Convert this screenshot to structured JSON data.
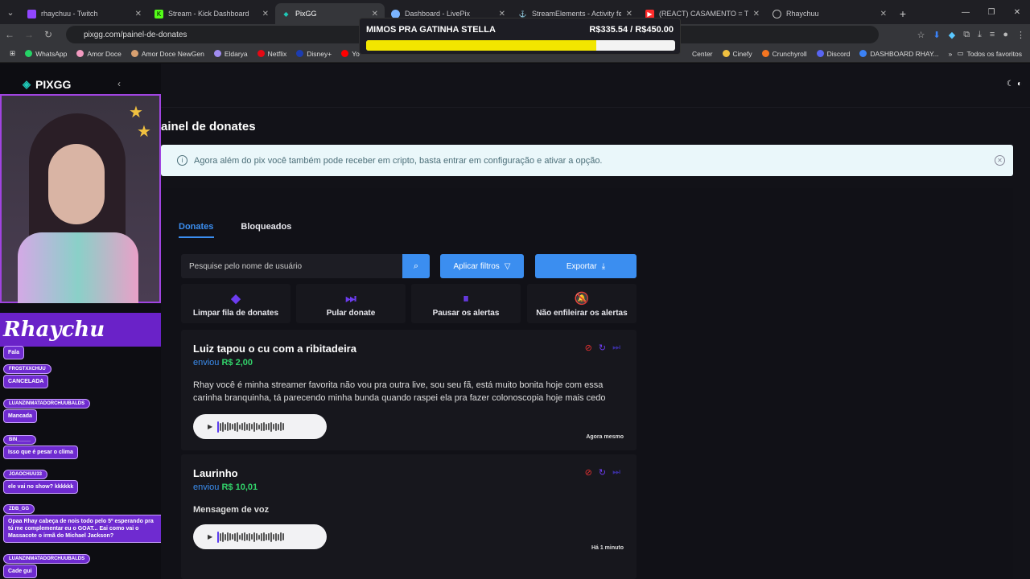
{
  "browser": {
    "tabs": [
      {
        "title": "rhaychuu - Twitch",
        "color": "#9146ff",
        "active": false
      },
      {
        "title": "Stream - Kick Dashboard",
        "color": "#53fc18",
        "active": false
      },
      {
        "title": "PixGG",
        "color": "#1fc7b6",
        "active": true
      },
      {
        "title": "Dashboard - LivePix",
        "color": "#7ab4ff",
        "active": false
      },
      {
        "title": "StreamElements - Activity feed",
        "color": "#ffffff",
        "active": false
      },
      {
        "title": "(REACT) CASAMENTO = TESTO",
        "color": "#ff2b2b",
        "active": false
      },
      {
        "title": "Rhaychuu",
        "color": "#bbbbbb",
        "active": false
      }
    ],
    "url": "pixgg.com/painel-de-donates",
    "bookmarks": [
      {
        "label": "WhatsApp",
        "color": "#25d366"
      },
      {
        "label": "Amor Doce",
        "color": "#f29ac0"
      },
      {
        "label": "Amor Doce NewGen",
        "color": "#d8a070"
      },
      {
        "label": "Eldarya",
        "color": "#a08cf0"
      },
      {
        "label": "Netflix",
        "color": "#e50914"
      },
      {
        "label": "Disney+",
        "color": "#1c3cb0"
      },
      {
        "label": "Yo",
        "color": "#ff0000"
      }
    ],
    "bookmarks_right": [
      {
        "label": "Center",
        "color": "#999999"
      },
      {
        "label": "Cinefy",
        "color": "#f0c040"
      },
      {
        "label": "Crunchyroll",
        "color": "#f47521"
      },
      {
        "label": "Discord",
        "color": "#5865f2"
      },
      {
        "label": "DASHBOARD RHAY...",
        "color": "#3b82f6"
      }
    ],
    "all_bookmarks": "Todos os favoritos"
  },
  "goal": {
    "title": "MIMOS PRA GATINHA STELLA",
    "value_text": "R$335.54 / R$450.00",
    "progress": 0.7456
  },
  "sidebar": {
    "logo_text": "PIXGG",
    "brand_text": "Rhaychu",
    "chat": [
      {
        "user": "",
        "msg": "Fala"
      },
      {
        "user": "FROSTXXCHUU",
        "msg": "CANCELADA"
      },
      {
        "user": "LUANZINMATADORCHUUBALDS",
        "msg": "Mancada"
      },
      {
        "user": "BIN_____",
        "msg": "Isso que é pesar o clima"
      },
      {
        "user": "JOAOCHUU33",
        "msg": "ele vai no show? kkkkkk"
      },
      {
        "user": "ZDB_GG",
        "msg": "Opaa Rhay cabeça de nois todo pelo 5º esperando pra tú me complementar eu o GOAT... Eai como vai o Massacote o irmã do Michael Jackson?"
      },
      {
        "user": "LUANZINMATADORCHUUBALDS",
        "msg": "Cade gui"
      }
    ]
  },
  "page": {
    "title": "ainel de donates",
    "info_text": "Agora além do pix você também pode receber em cripto, basta entrar em configuração e ativar a opção.",
    "tabs": [
      "Donates",
      "Bloqueados"
    ],
    "search_placeholder": "Pesquise pelo nome de usuário",
    "filter_label": "Aplicar filtros",
    "export_label": "Exportar",
    "actions": [
      "Limpar fila de donates",
      "Pular donate",
      "Pausar os alertas",
      "Não enfileirar os alertas"
    ]
  },
  "donates": [
    {
      "name": "Luiz tapou o cu com a ribitadeira",
      "sent_label": "enviou",
      "amount": "R$ 2,00",
      "message": "Rhay você é minha streamer favorita não vou pra outra live, sou seu fã, está muito bonita hoje com essa carinha branquinha, tá parecendo minha bunda quando raspei ela pra fazer colonoscopia hoje mais cedo",
      "time": "Agora mesmo"
    },
    {
      "name": "Laurinho",
      "sent_label": "enviou",
      "amount": "R$ 10,01",
      "message": "Mensagem de voz",
      "time": "Há 1 minuto"
    }
  ],
  "colors": {
    "accent": "#3b8ef0",
    "amount": "#32d26a",
    "block": "#e03030",
    "purple": "#6c3cf0"
  }
}
